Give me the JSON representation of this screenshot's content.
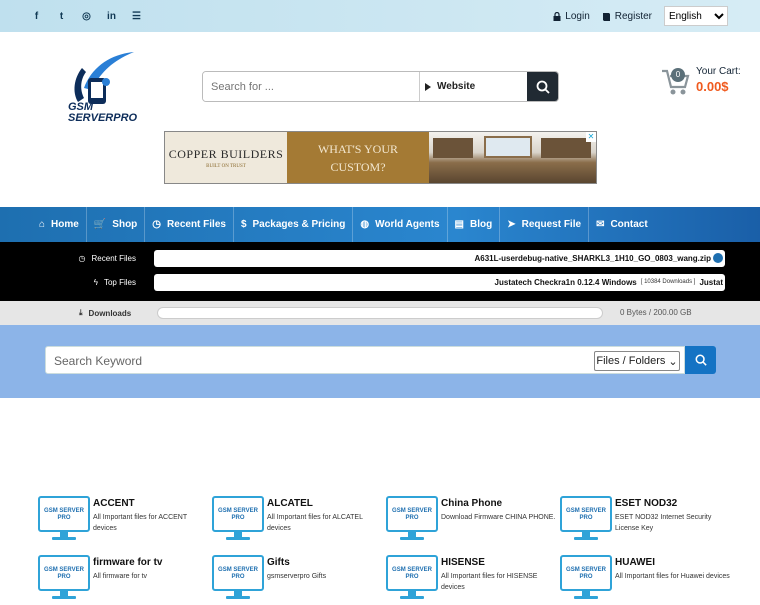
{
  "topbar": {
    "social": [
      {
        "icon": "facebook-icon",
        "glyph": "f"
      },
      {
        "icon": "twitter-icon",
        "glyph": "t"
      },
      {
        "icon": "instagram-icon",
        "glyph": "◎"
      },
      {
        "icon": "linkedin-icon",
        "glyph": "in"
      },
      {
        "icon": "rss-icon",
        "glyph": "☰"
      }
    ],
    "login_label": "Login",
    "register_label": "Register",
    "language": "English"
  },
  "logo": {
    "text_line1": "GSM",
    "text_line2": "SERVERPRO"
  },
  "search": {
    "placeholder": "Search for ...",
    "scope": "Website"
  },
  "cart": {
    "count": "0",
    "label": "Your Cart:",
    "amount": "0.00$"
  },
  "ad": {
    "brand": "COPPER BUILDERS",
    "tagline": "BUILT ON TRUST",
    "headline_1": "WHAT'S YOUR",
    "headline_2": "CUSTOM?",
    "close": "✕"
  },
  "nav": {
    "items": [
      {
        "label": "Home",
        "icon": "home-icon",
        "glyph": "⌂"
      },
      {
        "label": "Shop",
        "icon": "cart-icon",
        "glyph": "🛒"
      },
      {
        "label": "Recent Files",
        "icon": "clock-icon",
        "glyph": "◷"
      },
      {
        "label": "Packages & Pricing",
        "icon": "dollar-icon",
        "glyph": "$"
      },
      {
        "label": "World Agents",
        "icon": "globe-icon",
        "glyph": "◍"
      },
      {
        "label": "Blog",
        "icon": "book-icon",
        "glyph": "▤"
      },
      {
        "label": "Request File",
        "icon": "send-icon",
        "glyph": "➤"
      },
      {
        "label": "Contact",
        "icon": "envelope-icon",
        "glyph": "✉"
      }
    ]
  },
  "ticker": {
    "recent_label": "Recent Files",
    "recent_item": "A631L-userdebug-native_SHARKL3_1H10_GO_0803_wang.zip",
    "top_label": "Top Files",
    "top_item": "Justatech Checkra1n 0.12.4 Windows",
    "top_downloads": "[ 10384 Downloads ]",
    "top_next": "Justat"
  },
  "downloads": {
    "label": "Downloads",
    "progress": 0,
    "value": "0 Bytes / 200.00 GB"
  },
  "keyword": {
    "placeholder": "Search Keyword",
    "select": "Files / Folders"
  },
  "categories": [
    {
      "name": "ACCENT",
      "desc": "All Important files for ACCENT devices"
    },
    {
      "name": "ALCATEL",
      "desc": "All Important files for ALCATEL devices"
    },
    {
      "name": "China Phone",
      "desc": "Download Firmware CHINA PHONE."
    },
    {
      "name": "ESET NOD32",
      "desc": "ESET NOD32 Internet Security License Key"
    },
    {
      "name": "firmware for tv",
      "desc": "All firmware for tv"
    },
    {
      "name": "Gifts",
      "desc": "gsmserverpro Gifts"
    },
    {
      "name": "HISENSE",
      "desc": "All Important files for HISENSE devices"
    },
    {
      "name": "HUAWEI",
      "desc": "All Important files for Huawei devices"
    }
  ],
  "category_icon_text": "GSM SERVER PRO",
  "colors": {
    "accent": "#1e6fb0",
    "cart_amount": "#f05a1e",
    "keyword_band": "#8cb4e8"
  }
}
